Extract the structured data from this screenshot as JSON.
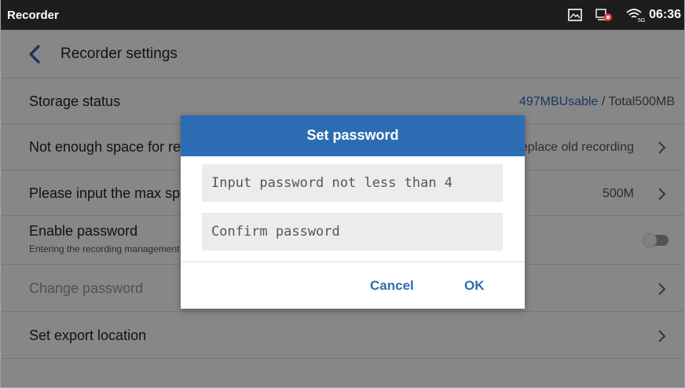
{
  "status_bar": {
    "app_name": "Recorder",
    "time": "06:36",
    "icons": [
      "screenshot-icon",
      "network-blocked-icon",
      "wifi-5g-icon"
    ],
    "network_label": "5G"
  },
  "header": {
    "title": "Recorder settings"
  },
  "settings": {
    "storage": {
      "label": "Storage status",
      "usable": "497MBUsable",
      "separator": " / ",
      "total": "Total500MB"
    },
    "not_enough_space": {
      "label": "Not enough space for recording",
      "value": "Replace old recording"
    },
    "max_space": {
      "label": "Please input the max space of recording",
      "value": "500M"
    },
    "enable_password": {
      "label": "Enable password",
      "sub": "Entering the recording management requires password",
      "enabled": false
    },
    "change_password": {
      "label": "Change password"
    },
    "export_location": {
      "label": "Set export location"
    }
  },
  "dialog": {
    "title": "Set password",
    "password_placeholder": "Input password not less than 4",
    "confirm_placeholder": "Confirm password",
    "cancel_label": "Cancel",
    "ok_label": "OK"
  },
  "colors": {
    "accent": "#2d6cb2",
    "status_bar": "#1d1d1d",
    "overlay": "rgba(0,0,0,0.47)"
  }
}
